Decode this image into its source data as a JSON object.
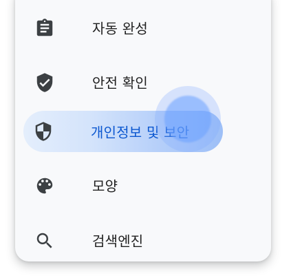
{
  "menu": {
    "items": [
      {
        "label": "자동 완성",
        "icon": "clipboard-icon",
        "selected": false
      },
      {
        "label": "안전 확인",
        "icon": "shield-check-icon",
        "selected": false
      },
      {
        "label": "개인정보 및 보안",
        "icon": "shield-half-icon",
        "selected": true
      },
      {
        "label": "모양",
        "icon": "palette-icon",
        "selected": false
      },
      {
        "label": "검색엔진",
        "icon": "search-icon",
        "selected": false
      }
    ]
  },
  "colors": {
    "icon": "#3c4043",
    "text": "#1f1f1f",
    "selected_text": "#0b57d0",
    "selected_background": "#d3e3fb",
    "card_background": "#f8f9fb"
  }
}
